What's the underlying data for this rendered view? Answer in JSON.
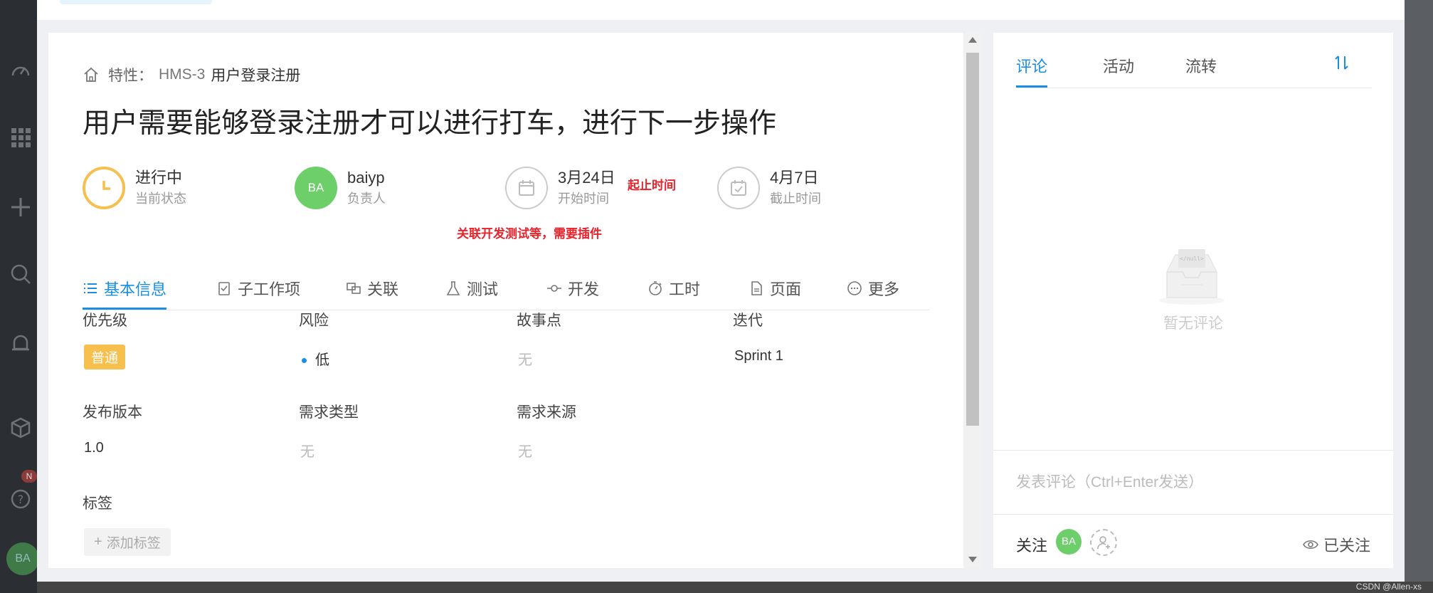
{
  "breadcrumb": {
    "type_label": "特性：",
    "code": "HMS-3",
    "parent": "用户登录注册"
  },
  "title": "用户需要能够登录注册才可以进行打车，进行下一步操作",
  "meta": {
    "status": {
      "value": "进行中",
      "label": "当前状态",
      "color": "#f5c04f"
    },
    "owner": {
      "initials": "BA",
      "value": "baiyp",
      "label": "负责人",
      "color": "#6ccf6a"
    },
    "start": {
      "value": "3月24日",
      "label": "开始时间"
    },
    "end": {
      "value": "4月7日",
      "label": "截止时间"
    }
  },
  "annotations": {
    "date_note": "起止时间",
    "plugin_note": "关联开发测试等，需要插件"
  },
  "tabs": [
    {
      "label": "基本信息",
      "icon": "list-icon",
      "active": true
    },
    {
      "label": "子工作项",
      "icon": "clipboard-check-icon"
    },
    {
      "label": "关联",
      "icon": "link-icon"
    },
    {
      "label": "测试",
      "icon": "flask-icon"
    },
    {
      "label": "开发",
      "icon": "commit-icon"
    },
    {
      "label": "工时",
      "icon": "stopwatch-icon"
    },
    {
      "label": "页面",
      "icon": "document-icon"
    },
    {
      "label": "更多",
      "icon": "more-icon"
    }
  ],
  "fields": {
    "priority": {
      "label": "优先级",
      "value": "普通"
    },
    "risk": {
      "label": "风险",
      "value": "低"
    },
    "story_points": {
      "label": "故事点",
      "value": "无"
    },
    "iteration": {
      "label": "迭代",
      "value": "Sprint 1"
    },
    "release": {
      "label": "发布版本",
      "value": "1.0"
    },
    "req_type": {
      "label": "需求类型",
      "value": "无"
    },
    "req_source": {
      "label": "需求来源",
      "value": "无"
    },
    "tags": {
      "label": "标签",
      "add_label": "添加标签"
    }
  },
  "right": {
    "tabs": [
      "评论",
      "活动",
      "流转"
    ],
    "sort_icon": "sort-icon",
    "empty_text": "暂无评论",
    "empty_illustration_text": "</null>",
    "comment_placeholder": "发表评论（Ctrl+Enter发送）",
    "follow_label": "关注",
    "follower_initials": "BA",
    "followed_label": "已关注"
  },
  "background": {
    "avatar": "BA",
    "badge": "N"
  },
  "watermark": "CSDN @Allen-xs",
  "colors": {
    "accent": "#1a8fe0",
    "priority": "#f7bf4e",
    "annotation": "#e8232b"
  }
}
